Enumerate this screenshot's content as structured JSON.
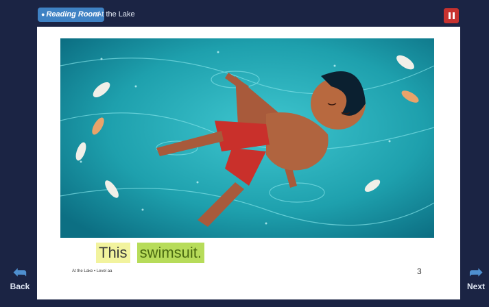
{
  "header": {
    "reading_room_label": "Reading Room",
    "book_title": "At the Lake"
  },
  "page": {
    "sentence_words": [
      "This",
      "swimsuit."
    ],
    "footer_note": "At the Lake • Level aa",
    "page_number": "3"
  },
  "nav": {
    "back_label": "Back",
    "next_label": "Next"
  },
  "colors": {
    "background": "#1b2444",
    "accent_button": "#3f82c4",
    "pause_button": "#c7322f",
    "highlight_word_1": "#f2f39e",
    "highlight_word_2": "#b7dc5a"
  }
}
